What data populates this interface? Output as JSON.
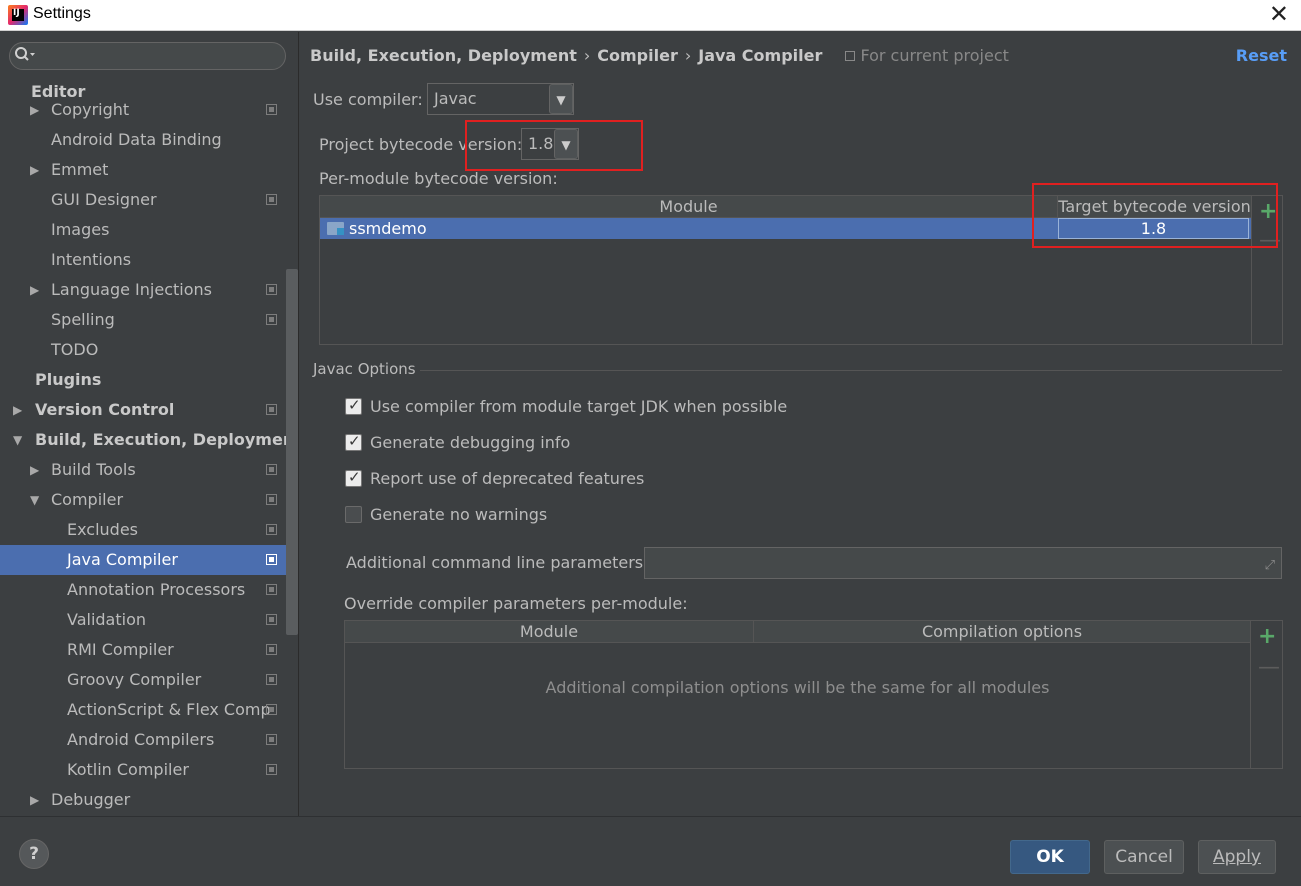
{
  "window": {
    "title": "Settings",
    "close_glyph": "✕"
  },
  "sidebar": {
    "search": {
      "placeholder": "",
      "value": ""
    },
    "editor_heading": "Editor",
    "items": [
      {
        "label": "Copyright",
        "indent": 1,
        "expandable": true,
        "project_icon": true
      },
      {
        "label": "Android Data Binding",
        "indent": 1,
        "expandable": false,
        "project_icon": false
      },
      {
        "label": "Emmet",
        "indent": 1,
        "expandable": true,
        "project_icon": false
      },
      {
        "label": "GUI Designer",
        "indent": 1,
        "expandable": false,
        "project_icon": true
      },
      {
        "label": "Images",
        "indent": 1,
        "expandable": false,
        "project_icon": false
      },
      {
        "label": "Intentions",
        "indent": 1,
        "expandable": false,
        "project_icon": false
      },
      {
        "label": "Language Injections",
        "indent": 1,
        "expandable": true,
        "project_icon": true
      },
      {
        "label": "Spelling",
        "indent": 1,
        "expandable": false,
        "project_icon": true
      },
      {
        "label": "TODO",
        "indent": 1,
        "expandable": false,
        "project_icon": false
      },
      {
        "label": "Plugins",
        "indent": 0,
        "expandable": false,
        "project_icon": false,
        "bold": true
      },
      {
        "label": "Version Control",
        "indent": 0,
        "expandable": true,
        "project_icon": true,
        "bold": true
      },
      {
        "label": "Build, Execution, Deployment",
        "indent": 0,
        "expandable": true,
        "expanded": true,
        "project_icon": false,
        "bold": true
      },
      {
        "label": "Build Tools",
        "indent": 1,
        "expandable": true,
        "project_icon": true
      },
      {
        "label": "Compiler",
        "indent": 1,
        "expandable": true,
        "expanded": true,
        "project_icon": true
      },
      {
        "label": "Excludes",
        "indent": 2,
        "expandable": false,
        "project_icon": true
      },
      {
        "label": "Java Compiler",
        "indent": 2,
        "expandable": false,
        "project_icon": true,
        "selected": true
      },
      {
        "label": "Annotation Processors",
        "indent": 2,
        "expandable": false,
        "project_icon": true
      },
      {
        "label": "Validation",
        "indent": 2,
        "expandable": false,
        "project_icon": true
      },
      {
        "label": "RMI Compiler",
        "indent": 2,
        "expandable": false,
        "project_icon": true
      },
      {
        "label": "Groovy Compiler",
        "indent": 2,
        "expandable": false,
        "project_icon": true
      },
      {
        "label": "ActionScript & Flex Comp",
        "indent": 2,
        "expandable": false,
        "project_icon": true
      },
      {
        "label": "Android Compilers",
        "indent": 2,
        "expandable": false,
        "project_icon": true
      },
      {
        "label": "Kotlin Compiler",
        "indent": 2,
        "expandable": false,
        "project_icon": true
      },
      {
        "label": "Debugger",
        "indent": 1,
        "expandable": true,
        "project_icon": false
      }
    ]
  },
  "header": {
    "breadcrumb": [
      "Build, Execution, Deployment",
      "Compiler",
      "Java Compiler"
    ],
    "breadcrumb_sep": "›",
    "scope": "For current project",
    "reset": "Reset"
  },
  "compiler": {
    "use_compiler_label": "Use compiler:",
    "use_compiler_value": "Javac",
    "project_bytecode_label": "Project bytecode version:",
    "project_bytecode_value": "1.8",
    "per_module_label": "Per-module bytecode version:",
    "module_table": {
      "columns": [
        "Module",
        "Target bytecode version"
      ],
      "rows": [
        {
          "module": "ssmdemo",
          "target": "1.8"
        }
      ]
    }
  },
  "javac_options": {
    "title": "Javac Options",
    "checkboxes": [
      {
        "label": "Use compiler from module target JDK when possible",
        "checked": true
      },
      {
        "label": "Generate debugging info",
        "checked": true
      },
      {
        "label": "Report use of deprecated features",
        "checked": true
      },
      {
        "label": "Generate no warnings",
        "checked": false
      }
    ],
    "additional_params_label": "Additional command line parameters:",
    "additional_params_value": "",
    "override_label": "Override compiler parameters per-module:",
    "override_table": {
      "columns": [
        "Module",
        "Compilation options"
      ],
      "empty_text": "Additional compilation options will be the same for all modules"
    }
  },
  "footer": {
    "help": "?",
    "ok": "OK",
    "cancel": "Cancel",
    "apply": "Apply"
  },
  "icons": {
    "dropdown": "▼",
    "expand": "▶",
    "collapse": "▼",
    "add": "+",
    "remove": "—",
    "tick": "✓",
    "search": "🔍︎",
    "expand_field": "⤢"
  },
  "colors": {
    "background": "#3c3f41",
    "selection": "#4b6eaf",
    "link": "#589df6",
    "add": "#59a869",
    "highlight_box": "#e02020",
    "primary_button": "#365880"
  }
}
